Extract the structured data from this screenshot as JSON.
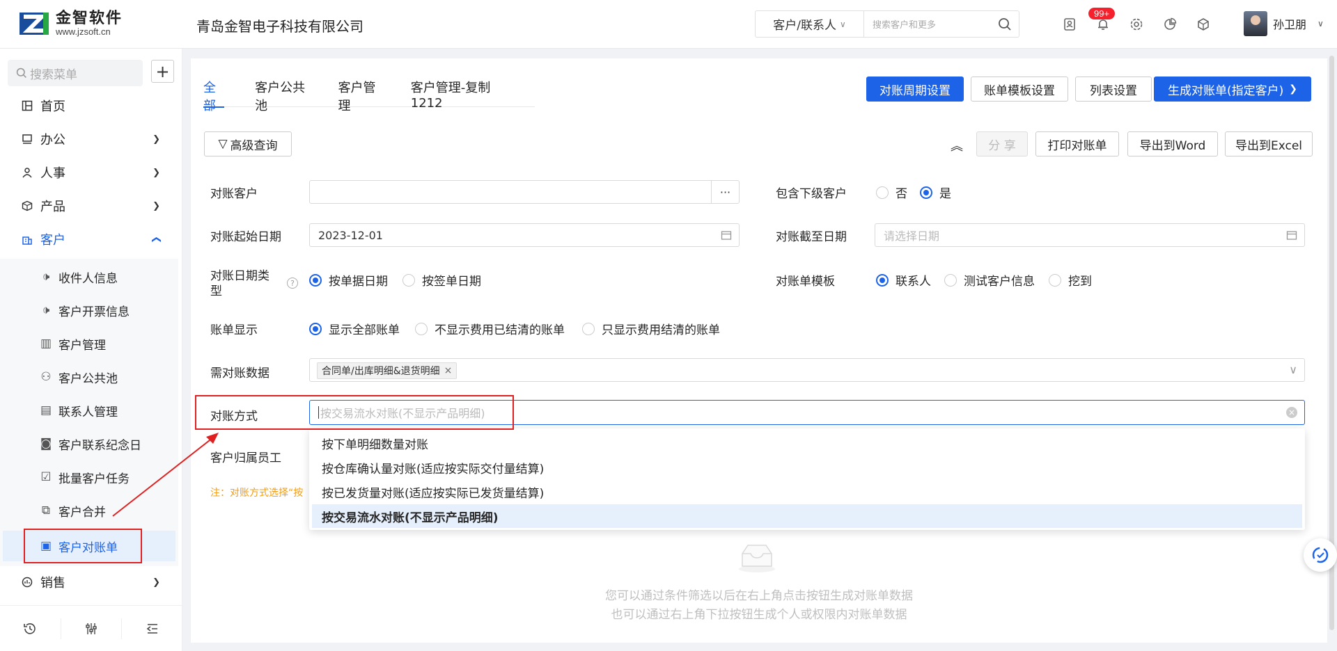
{
  "header": {
    "logo_text": "金智软件",
    "logo_url": "www.jzsoft.cn",
    "company": "青岛金智电子科技有限公司",
    "search_category": "客户/联系人",
    "search_placeholder": "搜索客户和更多",
    "notification_badge": "99+",
    "user_name": "孙卫朋"
  },
  "sidebar": {
    "search_placeholder": "搜索菜单",
    "items": [
      {
        "label": "首页"
      },
      {
        "label": "办公"
      },
      {
        "label": "人事"
      },
      {
        "label": "产品"
      },
      {
        "label": "客户"
      },
      {
        "label": "销售"
      }
    ],
    "customer_sub": [
      {
        "label": "收件人信息"
      },
      {
        "label": "客户开票信息"
      },
      {
        "label": "客户管理"
      },
      {
        "label": "客户公共池"
      },
      {
        "label": "联系人管理"
      },
      {
        "label": "客户联系纪念日"
      },
      {
        "label": "批量客户任务"
      },
      {
        "label": "客户合并"
      },
      {
        "label": "客户对账单"
      }
    ]
  },
  "tabs": [
    "全部",
    "客户公共池",
    "客户管理",
    "客户管理-复制1212"
  ],
  "toolbar": {
    "cycle_settings": "对账周期设置",
    "template_settings": "账单模板设置",
    "list_settings": "列表设置",
    "generate": "生成对账单(指定客户)",
    "advanced_query": "高级查询",
    "share": "分 享",
    "print": "打印对账单",
    "export_word": "导出到Word",
    "export_excel": "导出到Excel"
  },
  "form": {
    "customer_label": "对账客户",
    "include_sub_label": "包含下级客户",
    "include_sub_options": [
      "否",
      "是"
    ],
    "start_date_label": "对账起始日期",
    "start_date_value": "2023-12-01",
    "end_date_label": "对账截至日期",
    "end_date_placeholder": "请选择日期",
    "date_type_label": "对账日期类型",
    "date_type_options": [
      "按单据日期",
      "按签单日期"
    ],
    "template_label": "对账单模板",
    "template_options": [
      "联系人",
      "测试客户信息",
      "挖到"
    ],
    "bill_display_label": "账单显示",
    "bill_display_options": [
      "显示全部账单",
      "不显示费用已结清的账单",
      "只显示费用结清的账单"
    ],
    "data_label": "需对账数据",
    "data_tag": "合同单/出库明细&退货明细",
    "method_label": "对账方式",
    "method_placeholder": "按交易流水对账(不显示产品明细)",
    "owner_label": "客户归属员工",
    "note": "注：对账方式选择“按"
  },
  "dropdown_options": [
    "按下单明细数量对账",
    "按仓库确认量对账(适应按实际交付量结算)",
    "按已发货量对账(适应按实际已发货量结算)",
    "按交易流水对账(不显示产品明细)"
  ],
  "empty": {
    "line1": "您可以通过条件筛选以后在右上角点击按钮生成对账单数据",
    "line2": "也可以通过右上角下拉按钮生成个人或权限内对账单数据"
  },
  "colors": {
    "accent": "#1d63e8",
    "annotation": "#e02020"
  }
}
